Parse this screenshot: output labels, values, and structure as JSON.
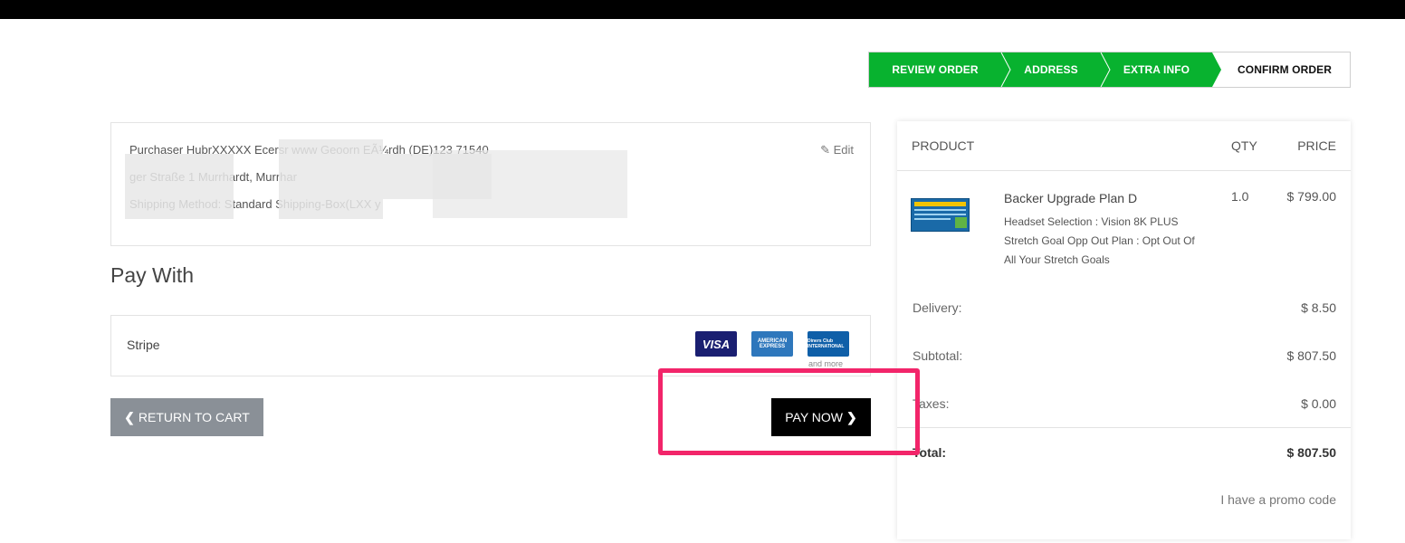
{
  "steps": [
    {
      "label": "REVIEW ORDER"
    },
    {
      "label": "ADDRESS"
    },
    {
      "label": "EXTRA INFO"
    },
    {
      "label": "CONFIRM ORDER"
    }
  ],
  "info": {
    "line1": "Purchaser  HubrXXXXX  Ecersr  www  Geoorn EÃ¼rdh (DE)123 71540",
    "line2": "  ger Straße 1 Murrhardt, Murrhar",
    "line3": "Shipping Method:  Standard Shipping-Box(LXX  y",
    "edit": "Edit"
  },
  "pay_with": {
    "title": "Pay With",
    "method": "Stripe",
    "cards": [
      "VISA",
      "AMERICAN EXPRESS",
      "Diners Club INTERNATIONAL"
    ],
    "and_more": "and more"
  },
  "actions": {
    "return_label": "RETURN TO CART",
    "pay_label": "PAY NOW"
  },
  "summary": {
    "headers": {
      "product": "PRODUCT",
      "qty": "QTY",
      "price": "PRICE"
    },
    "item": {
      "thumb_title": "Backer Upgrade Plan D",
      "name": "Backer Upgrade Plan D",
      "option1": "Headset Selection : Vision 8K PLUS",
      "option2": "Stretch Goal Opp Out Plan : Opt Out Of",
      "option3": "All Your Stretch Goals",
      "qty": "1.0",
      "price": "$ 799.00"
    },
    "delivery_label": "Delivery:",
    "delivery_value": "$ 8.50",
    "subtotal_label": "Subtotal:",
    "subtotal_value": "$ 807.50",
    "taxes_label": "Taxes:",
    "taxes_value": "$ 0.00",
    "total_label": "Total:",
    "total_value": "$ 807.50",
    "promo": "I have a promo code"
  },
  "colors": {
    "accent": "#08b22f",
    "highlight": "#f2256a",
    "pay_button": "#000000",
    "return_button": "#8a9097"
  }
}
